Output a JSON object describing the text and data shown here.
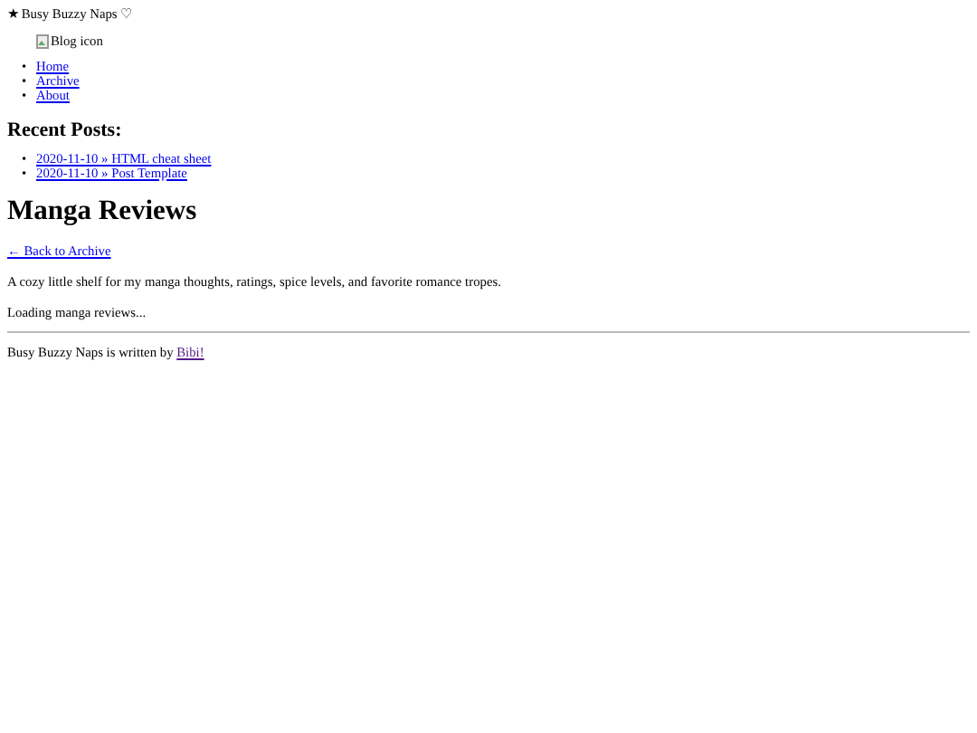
{
  "header": {
    "title": "★ Busy Buzzy Naps ♡",
    "logo_alt": "Blog icon"
  },
  "nav": [
    {
      "bullet": "•",
      "label": "Home"
    },
    {
      "bullet": "•",
      "label": "Archive"
    },
    {
      "bullet": "•",
      "label": "About"
    }
  ],
  "recent_posts": {
    "heading": "Recent Posts:",
    "items": [
      {
        "bullet": "•",
        "label": "2020-11-10 » HTML cheat sheet"
      },
      {
        "bullet": "•",
        "label": "2020-11-10 » Post Template"
      }
    ]
  },
  "main": {
    "title": "Manga Reviews",
    "back_link": "← Back to Archive",
    "description": "A cozy little shelf for my manga thoughts, ratings, spice levels, and favorite romance tropes.",
    "status": "Loading manga reviews..."
  },
  "footer": {
    "text": "Busy Buzzy Naps is written by",
    "link": {
      "label": "Bibi!",
      "visited": true
    }
  }
}
